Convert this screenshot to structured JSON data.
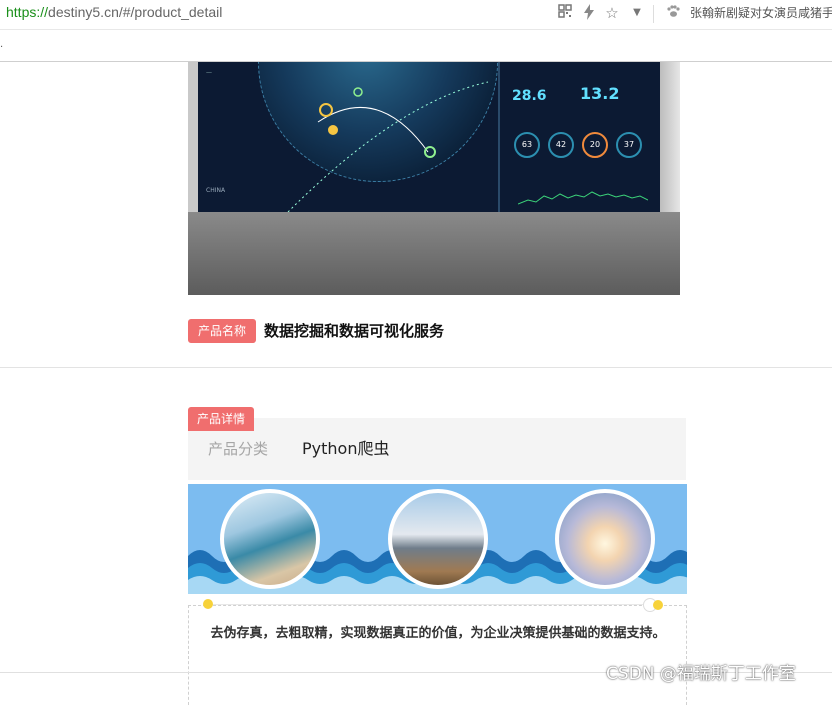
{
  "browser": {
    "url_scheme": "https://",
    "url_rest": "destiny5.cn/#/product_detail",
    "news_text": "张翰新剧疑对女演员咸猪手",
    "icons": [
      "qr-code-icon",
      "lightning-icon",
      "star-icon",
      "chevron-down-icon",
      "paw-icon"
    ]
  },
  "hero": {
    "stat1": "28.6",
    "stat2": "13.2",
    "rings": [
      "63",
      "42",
      "20",
      "37"
    ]
  },
  "product": {
    "name_badge": "产品名称",
    "name": "数据挖掘和数据可视化服务",
    "detail_badge": "产品详情",
    "category_label": "产品分类",
    "category_value": "Python爬虫",
    "description": "去伪存真，去粗取精，实现数据真正的价值，为企业决策提供基础的数据支持。"
  },
  "watermark": "CSDN @福瑞斯丁工作室"
}
